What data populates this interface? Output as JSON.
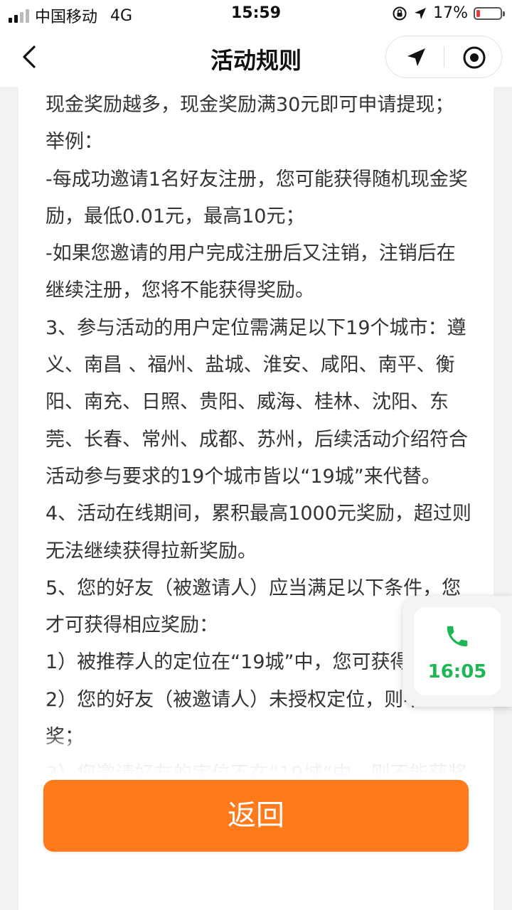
{
  "status_bar": {
    "carrier": "中国移动",
    "network": "4G",
    "time": "15:59",
    "battery_percent": "17%",
    "battery_level": 0.17
  },
  "nav": {
    "title": "活动规则"
  },
  "rules": {
    "lines": [
      "现金奖励越多，现金奖励满30元即可申请提现；",
      "举例：",
      "-每成功邀请1名好友注册，您可能获得随机现金奖",
      "励，最低0.01元，最高10元；",
      "-如果您邀请的用户完成注册后又注销，注销后在",
      "继续注册，您将不能获得奖励。",
      "3、参与活动的用户定位需满足以下19个城市：遵",
      "义、南昌 、福州、盐城、淮安、咸阳、南平、衡",
      "阳、南充、日照、贵阳、威海、桂林、沈阳、东",
      "莞、长春、常州、成都、苏州，后续活动介绍符合",
      "活动参与要求的19个城市皆以“19城”来代替。",
      "4、活动在线期间，累积最高1000元奖励，超过则",
      "无法继续获得拉新奖励。",
      "5、您的好友（被邀请人）应当满足以下条件，您",
      "才可获得相应奖励：",
      "1）被推荐人的定位在“19城”中，您可获得奖",
      "2）您的好友（被邀请人）未授权定位，则不",
      "奖；",
      "3）您邀请好友的定位不在“19城”中，则不能获奖"
    ]
  },
  "return_button": {
    "label": "返回",
    "color": "#ff7a1a"
  },
  "call_widget": {
    "time": "16:05",
    "icon": "phone-icon",
    "color": "#1fb655"
  }
}
